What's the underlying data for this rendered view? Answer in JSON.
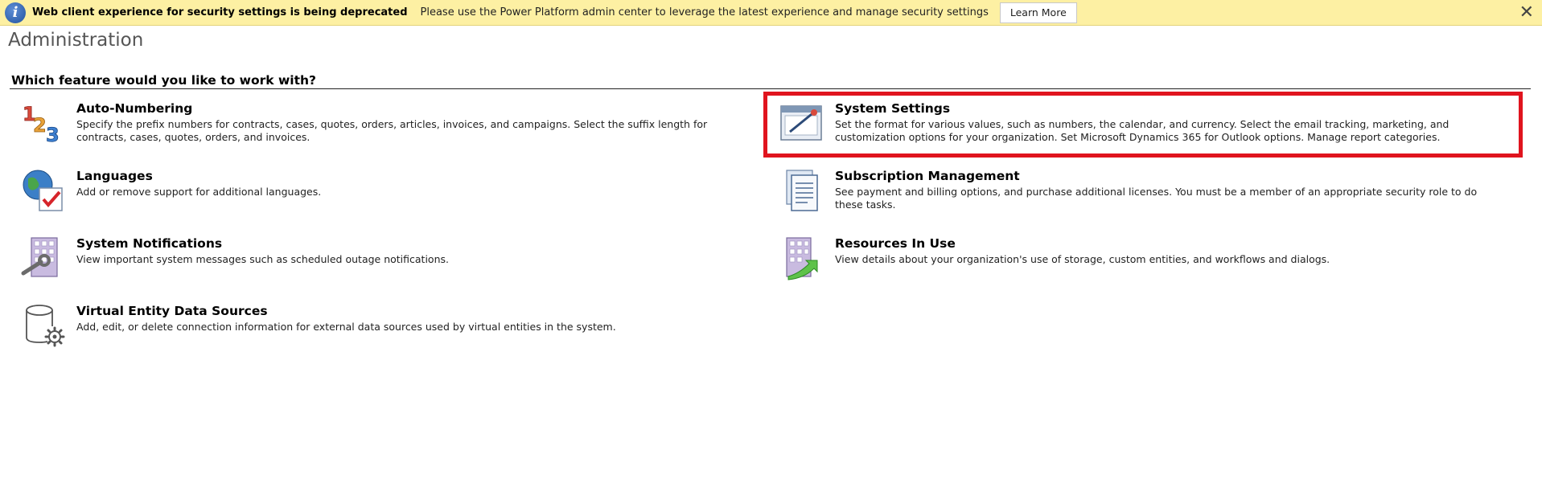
{
  "notification": {
    "title": "Web client experience for security settings is being deprecated",
    "message": "Please use the Power Platform admin center to leverage the latest experience and manage security settings",
    "learn_more": "Learn More",
    "info_glyph": "i",
    "close_glyph": "✕"
  },
  "page": {
    "title": "Administration",
    "question": "Which feature would you like to work with?"
  },
  "features": [
    {
      "title": "Auto-Numbering",
      "description": "Specify the prefix numbers for contracts, cases, quotes, orders, articles, invoices, and campaigns. Select the suffix length for contracts, cases, quotes, orders, and invoices.",
      "icon": "numbers-icon"
    },
    {
      "title": "System Settings",
      "description": "Set the format for various values, such as numbers, the calendar, and currency. Select the email tracking, marketing, and customization options for your organization. Set Microsoft Dynamics 365 for Outlook options. Manage report categories.",
      "icon": "settings-window-icon"
    },
    {
      "title": "Languages",
      "description": "Add or remove support for additional languages.",
      "icon": "globe-check-icon"
    },
    {
      "title": "Subscription Management",
      "description": "See payment and billing options, and purchase additional licenses. You must be a member of an appropriate security role to do these tasks.",
      "icon": "document-stack-icon"
    },
    {
      "title": "System Notifications",
      "description": "View important system messages such as scheduled outage notifications.",
      "icon": "building-wrench-icon"
    },
    {
      "title": "Resources In Use",
      "description": "View details about your organization's use of storage, custom entities, and workflows and dialogs.",
      "icon": "building-arrow-icon"
    },
    {
      "title": "Virtual Entity Data Sources",
      "description": "Add, edit, or delete connection information for external data sources used by virtual entities in the system.",
      "icon": "database-gear-icon"
    }
  ],
  "colors": {
    "notification_bg": "#fdf0a3",
    "highlight_border": "#e0141e"
  }
}
